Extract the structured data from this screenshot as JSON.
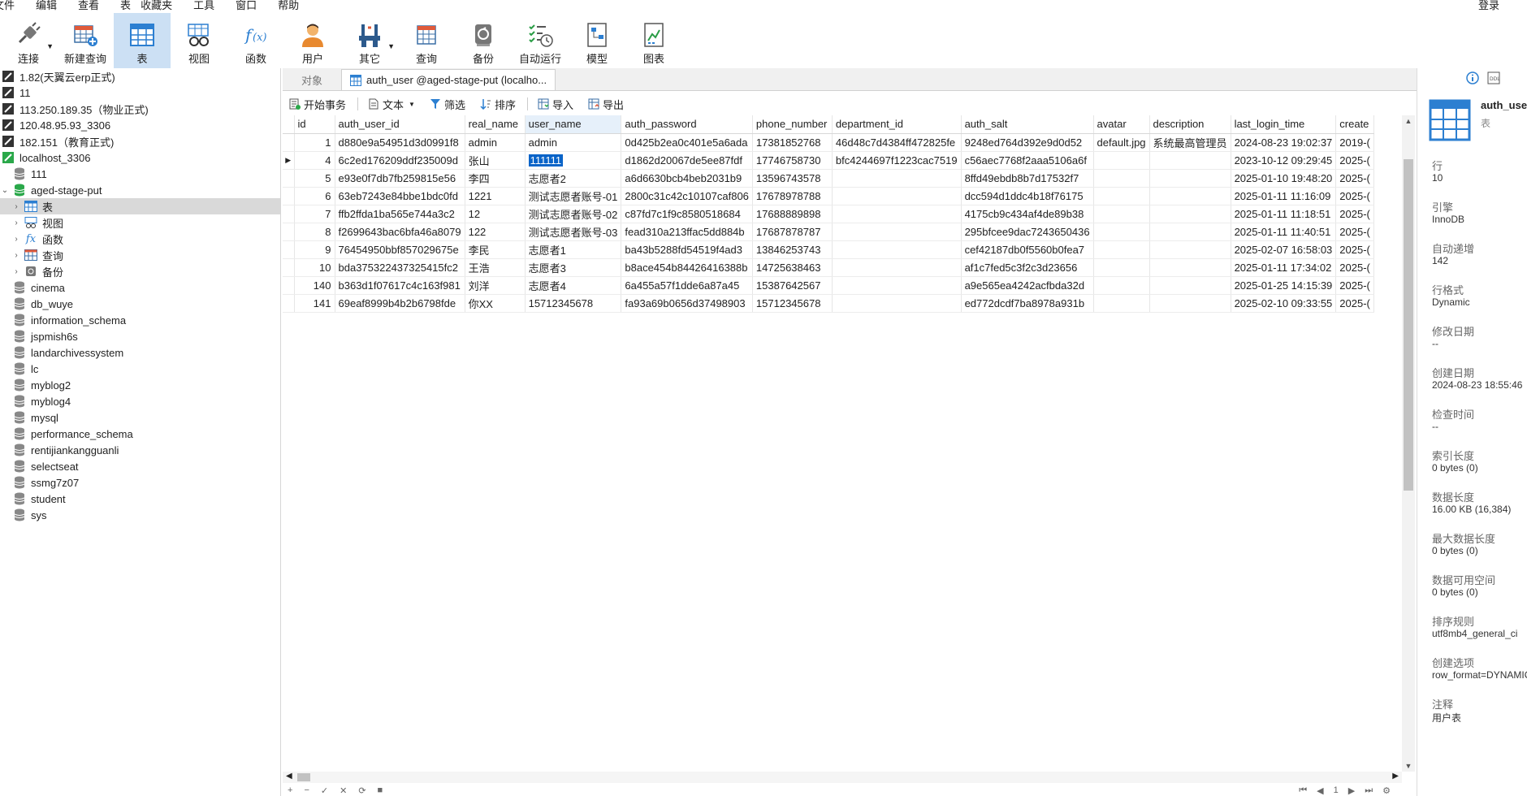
{
  "menubar": {
    "items": [
      "文件",
      "编辑",
      "查看",
      "表",
      "收藏夹",
      "工具",
      "窗口",
      "帮助"
    ],
    "login": "登录"
  },
  "toolbar": {
    "items": [
      {
        "label": "连接",
        "icon": "connection-icon",
        "caret": true
      },
      {
        "label": "新建查询",
        "icon": "new-query-icon"
      },
      {
        "label": "表",
        "icon": "table-icon",
        "active": true
      },
      {
        "label": "视图",
        "icon": "view-icon"
      },
      {
        "label": "函数",
        "icon": "function-icon"
      },
      {
        "label": "用户",
        "icon": "user-icon"
      },
      {
        "label": "其它",
        "icon": "tools-icon",
        "caret": true
      },
      {
        "label": "查询",
        "icon": "query-icon"
      },
      {
        "label": "备份",
        "icon": "backup-icon"
      },
      {
        "label": "自动运行",
        "icon": "automation-icon"
      },
      {
        "label": "模型",
        "icon": "model-icon"
      },
      {
        "label": "图表",
        "icon": "chart-icon"
      }
    ]
  },
  "tree": {
    "connections": [
      {
        "label": "1.82(天翼云erp正式)",
        "status": "off"
      },
      {
        "label": "11",
        "status": "off"
      },
      {
        "label": "113.250.189.35（物业正式)",
        "status": "off"
      },
      {
        "label": "120.48.95.93_3306",
        "status": "off"
      },
      {
        "label": "182.151（教育正式)",
        "status": "off"
      },
      {
        "label": "localhost_3306",
        "status": "on"
      }
    ],
    "db_111": "111",
    "open_db": "aged-stage-put",
    "children": [
      {
        "label": "表",
        "icon": "table-icon",
        "selected": true
      },
      {
        "label": "视图",
        "icon": "view-icon"
      },
      {
        "label": "函数",
        "icon": "function-icon"
      },
      {
        "label": "查询",
        "icon": "query-icon"
      },
      {
        "label": "备份",
        "icon": "backup-icon"
      }
    ],
    "databases": [
      "cinema",
      "db_wuye",
      "information_schema",
      "jspmish6s",
      "landarchivessystem",
      "lc",
      "myblog2",
      "myblog4",
      "mysql",
      "performance_schema",
      "rentijiankangguanli",
      "selectseat",
      "ssmg7z07",
      "student",
      "sys"
    ]
  },
  "tabs": {
    "objects": "对象",
    "current": "auth_user @aged-stage-put (localho..."
  },
  "object_toolbar": {
    "begin_tx": "开始事务",
    "text": "文本",
    "filter": "筛选",
    "sort": "排序",
    "import": "导入",
    "export": "导出"
  },
  "grid": {
    "columns": [
      "id",
      "auth_user_id",
      "real_name",
      "user_name",
      "auth_password",
      "phone_number",
      "department_id",
      "auth_salt",
      "avatar",
      "description",
      "last_login_time",
      "create"
    ],
    "rows": [
      [
        "1",
        "d880e9a54951d3d0991f8",
        "admin",
        "admin",
        "0d425b2ea0c401e5a6ada",
        "17381852768",
        "46d48c7d4384ff472825fe",
        "9248ed764d392e9d0d52",
        "default.jpg",
        "系统最高管理员",
        "2024-08-23 19:02:37",
        "2019-("
      ],
      [
        "4",
        "6c2ed176209ddf235009d",
        "张山",
        "111111",
        "d1862d20067de5ee87fdf",
        "17746758730",
        "bfc4244697f1223cac7519",
        "c56aec7768f2aaa5106a6f",
        "",
        "",
        "2023-10-12 09:29:45",
        "2025-("
      ],
      [
        "5",
        "e93e0f7db7fb259815e56",
        "李四",
        "志愿者2",
        "a6d6630bcb4beb2031b9",
        "13596743578",
        "",
        "8ffd49ebdb8b7d17532f7",
        "",
        "",
        "2025-01-10 19:48:20",
        "2025-("
      ],
      [
        "6",
        "63eb7243e84bbe1bdc0fd",
        "1221",
        "测试志愿者账号-01",
        "2800c31c42c10107caf806",
        "17678978788",
        "",
        "dcc594d1ddc4b18f76175",
        "",
        "",
        "2025-01-11 11:16:09",
        "2025-("
      ],
      [
        "7",
        "ffb2ffda1ba565e744a3c2",
        "12",
        "测试志愿者账号-02",
        "c87fd7c1f9c8580518684",
        "17688889898",
        "",
        "4175cb9c434af4de89b38",
        "",
        "",
        "2025-01-11 11:18:51",
        "2025-("
      ],
      [
        "8",
        "f2699643bac6bfa46a8079",
        "122",
        "测试志愿者账号-03",
        "fead310a213ffac5dd884b",
        "17687878787",
        "",
        "295bfcee9dac7243650436",
        "",
        "",
        "2025-01-11 11:40:51",
        "2025-("
      ],
      [
        "9",
        "76454950bbf857029675e",
        "李民",
        "志愿者1",
        "ba43b5288fd54519f4ad3",
        "13846253743",
        "",
        "cef42187db0f5560b0fea7",
        "",
        "",
        "2025-02-07 16:58:03",
        "2025-("
      ],
      [
        "10",
        "bda375322437325415fc2",
        "王浩",
        "志愿者3",
        "b8ace454b84426416388b",
        "14725638463",
        "",
        "af1c7fed5c3f2c3d23656",
        "",
        "",
        "2025-01-11 17:34:02",
        "2025-("
      ],
      [
        "140",
        "b363d1f07617c4c163f981",
        "刘洋",
        "志愿者4",
        "6a455a57f1dde6a87a45",
        "15387642567",
        "",
        "a9e565ea4242acfbda32d",
        "",
        "",
        "2025-01-25 14:15:39",
        "2025-("
      ],
      [
        "141",
        "69eaf8999b4b2b6798fde",
        "你XX",
        "15712345678",
        "fa93a69b0656d37498903",
        "15712345678",
        "",
        "ed772dcdf7ba8978a931b",
        "",
        "",
        "2025-02-10 09:33:55",
        "2025-("
      ]
    ],
    "current_row": 1,
    "selected_col": 3
  },
  "status": {
    "left": [
      "+",
      "−",
      "✓",
      "✕",
      "⟳",
      "■"
    ],
    "pager": [
      "⏮",
      "◀",
      "1",
      "▶",
      "⏭",
      "⚙"
    ]
  },
  "info": {
    "table_name": "auth_user",
    "table_type": "表",
    "props": [
      {
        "k": "行",
        "v": "10"
      },
      {
        "k": "引擎",
        "v": "InnoDB"
      },
      {
        "k": "自动递增",
        "v": "142"
      },
      {
        "k": "行格式",
        "v": "Dynamic"
      },
      {
        "k": "修改日期",
        "v": "--"
      },
      {
        "k": "创建日期",
        "v": "2024-08-23 18:55:46"
      },
      {
        "k": "检查时间",
        "v": "--"
      },
      {
        "k": "索引长度",
        "v": "0 bytes (0)"
      },
      {
        "k": "数据长度",
        "v": "16.00 KB (16,384)"
      },
      {
        "k": "最大数据长度",
        "v": "0 bytes (0)"
      },
      {
        "k": "数据可用空间",
        "v": "0 bytes (0)"
      },
      {
        "k": "排序规则",
        "v": "utf8mb4_general_ci"
      },
      {
        "k": "创建选项",
        "v": "row_format=DYNAMIC"
      },
      {
        "k": "注释",
        "v": "用户表"
      }
    ]
  }
}
